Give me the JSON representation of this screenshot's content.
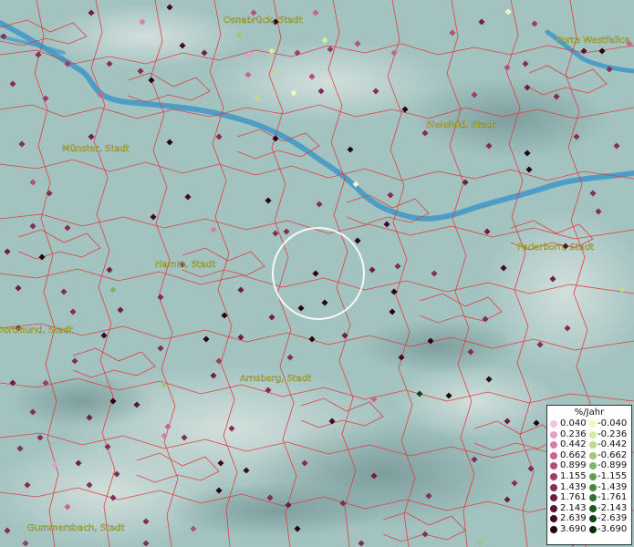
{
  "cities": [
    {
      "id": "osnabrueck",
      "label": "Osnabrück, Stadt"
    },
    {
      "id": "porta",
      "label": "Porta Westfalica"
    },
    {
      "id": "bielefeld",
      "label": "Bielefeld, Stadt"
    },
    {
      "id": "muenster",
      "label": "Münster, Stadt"
    },
    {
      "id": "paderborn",
      "label": "Paderborn, Stadt"
    },
    {
      "id": "hamm",
      "label": "Hamm, Stadt"
    },
    {
      "id": "dortmund",
      "label": "Dortmund, Stadt"
    },
    {
      "id": "arnsberg",
      "label": "Arnsberg, Stadt"
    },
    {
      "id": "gummersbach",
      "label": "Gummersbach, Stadt"
    }
  ],
  "legend": {
    "title": "%/Jahr",
    "positive": [
      {
        "label": "0.040",
        "color": "#f3c0e6"
      },
      {
        "label": "0.236",
        "color": "#e79ccc"
      },
      {
        "label": "0.442",
        "color": "#d87cb0"
      },
      {
        "label": "0.662",
        "color": "#c56595"
      },
      {
        "label": "0.899",
        "color": "#b0507e"
      },
      {
        "label": "1.155",
        "color": "#9a3d69"
      },
      {
        "label": "1.439",
        "color": "#842d56"
      },
      {
        "label": "1.761",
        "color": "#6e1f44"
      },
      {
        "label": "2.143",
        "color": "#581434"
      },
      {
        "label": "2.639",
        "color": "#400b24"
      },
      {
        "label": "3.690",
        "color": "#260413"
      }
    ],
    "negative": [
      {
        "label": "-0.040",
        "color": "#f2f6c0"
      },
      {
        "label": "-0.236",
        "color": "#d8eaa2"
      },
      {
        "label": "-0.442",
        "color": "#bcdb8e"
      },
      {
        "label": "-0.662",
        "color": "#9dc77a"
      },
      {
        "label": "-0.899",
        "color": "#7fb466"
      },
      {
        "label": "-1.155",
        "color": "#5f9e52"
      },
      {
        "label": "-1.439",
        "color": "#45883e"
      },
      {
        "label": "-1.761",
        "color": "#2f712e"
      },
      {
        "label": "-2.143",
        "color": "#1d5a20"
      },
      {
        "label": "-2.639",
        "color": "#0f4414"
      },
      {
        "label": "-3.690",
        "color": "#052a09"
      }
    ]
  },
  "colors": {
    "boundary": "#e2383a",
    "river": "#3f97c7",
    "selection_circle": "#ffffff"
  }
}
